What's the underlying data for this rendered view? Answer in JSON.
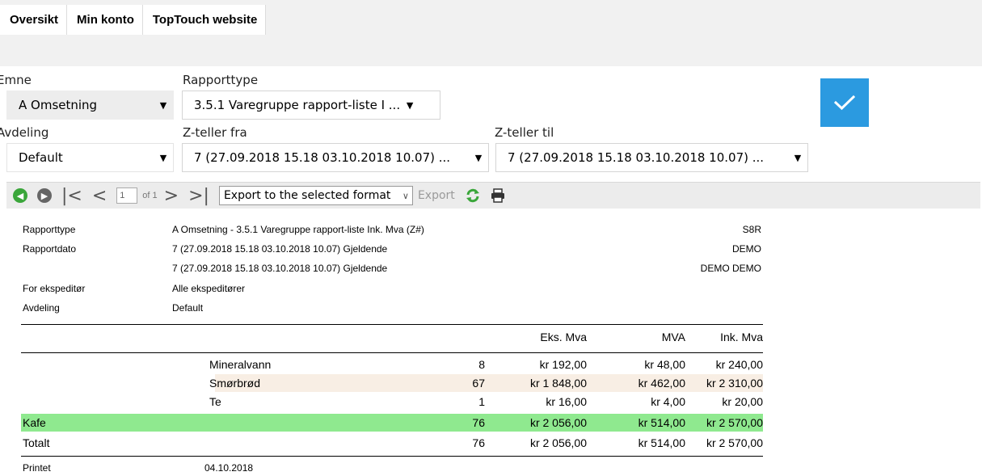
{
  "nav": {
    "tabs": [
      "Oversikt",
      "Min konto",
      "TopTouch website"
    ]
  },
  "params": {
    "emne_label": "Emne",
    "emne_value": "A Omsetning",
    "rapporttype_label": "Rapporttype",
    "rapporttype_value": "3.5.1 Varegruppe rapport-liste I ...",
    "avdeling_label": "Avdeling",
    "avdeling_value": "Default",
    "zfra_label": "Z-teller fra",
    "zfra_value": "7 (27.09.2018 15.18 03.10.2018 10.07) ...",
    "ztil_label": "Z-teller til",
    "ztil_value": "7 (27.09.2018 15.18 03.10.2018 10.07) ..."
  },
  "toolbar": {
    "page": "1",
    "of_pages": "of 1",
    "export_format": "Export to the selected format",
    "export_label": "Export"
  },
  "report": {
    "meta": {
      "rapporttype_label": "Rapporttype",
      "rapporttype_value": "A Omsetning - 3.5.1 Varegruppe rapport-liste Ink. Mva (Z#)",
      "rapportdato_label": "Rapportdato",
      "rapportdato_value1": "7 (27.09.2018 15.18 03.10.2018 10.07) Gjeldende",
      "rapportdato_value2": "7 (27.09.2018 15.18 03.10.2018 10.07) Gjeldende",
      "ekspeditor_label": "For ekspeditør",
      "ekspeditor_value": "Alle ekspeditører",
      "avdeling_label": "Avdeling",
      "avdeling_value": "Default",
      "right1": "S8R",
      "right2": "DEMO",
      "right3": "DEMO DEMO"
    },
    "columns": {
      "eks": "Eks. Mva",
      "mva": "MVA",
      "ink": "Ink. Mva"
    },
    "items": [
      {
        "name": "Mineralvann",
        "qty": "8",
        "eks": "kr 192,00",
        "mva": "kr 48,00",
        "ink": "kr 240,00"
      },
      {
        "name": "Smørbrød",
        "qty": "67",
        "eks": "kr 1 848,00",
        "mva": "kr 462,00",
        "ink": "kr 2 310,00"
      },
      {
        "name": "Te",
        "qty": "1",
        "eks": "kr 16,00",
        "mva": "kr 4,00",
        "ink": "kr 20,00"
      }
    ],
    "group": {
      "name": "Kafe",
      "qty": "76",
      "eks": "kr 2 056,00",
      "mva": "kr 514,00",
      "ink": "kr 2 570,00"
    },
    "total": {
      "name": "Totalt",
      "qty": "76",
      "eks": "kr 2 056,00",
      "mva": "kr 514,00",
      "ink": "kr 2 570,00"
    },
    "printed_label": "Printet",
    "printed_value": "04.10.2018"
  },
  "colors": {
    "accent": "#2b9ae0",
    "group_row": "#8fe98f",
    "alt_row": "#f8eee4"
  }
}
